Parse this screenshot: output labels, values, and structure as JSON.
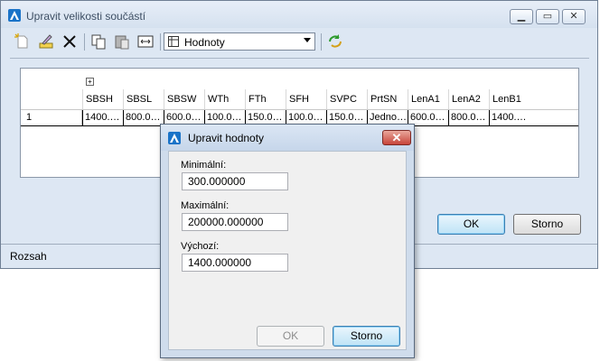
{
  "main_window": {
    "title": "Upravit velikosti součástí",
    "toolbar": {
      "view_selected": "Hodnoty"
    },
    "grid": {
      "columns": [
        "SBSH",
        "SBSL",
        "SBSW",
        "WTh",
        "FTh",
        "SFH",
        "SVPC",
        "PrtSN",
        "LenA1",
        "LenA2",
        "LenB1"
      ],
      "row_label": "1",
      "row_values": [
        "1400.…",
        "800.0…",
        "600.0…",
        "100.0…",
        "150.0…",
        "100.0…",
        "150.0…",
        "Jedno…",
        "600.0…",
        "800.0…",
        "1400.…"
      ]
    },
    "ok_label": "OK",
    "cancel_label": "Storno",
    "status": "Rozsah"
  },
  "dialog": {
    "title": "Upravit hodnoty",
    "min_label": "Minimální:",
    "min_value": "300.000000",
    "max_label": "Maximální:",
    "max_value": "200000.000000",
    "default_label": "Výchozí:",
    "default_value": "1400.000000",
    "ok_label": "OK",
    "cancel_label": "Storno"
  },
  "colors": {
    "window_bg": "#dde7f3",
    "accent": "#1a73c8",
    "close_red": "#c7443a"
  }
}
